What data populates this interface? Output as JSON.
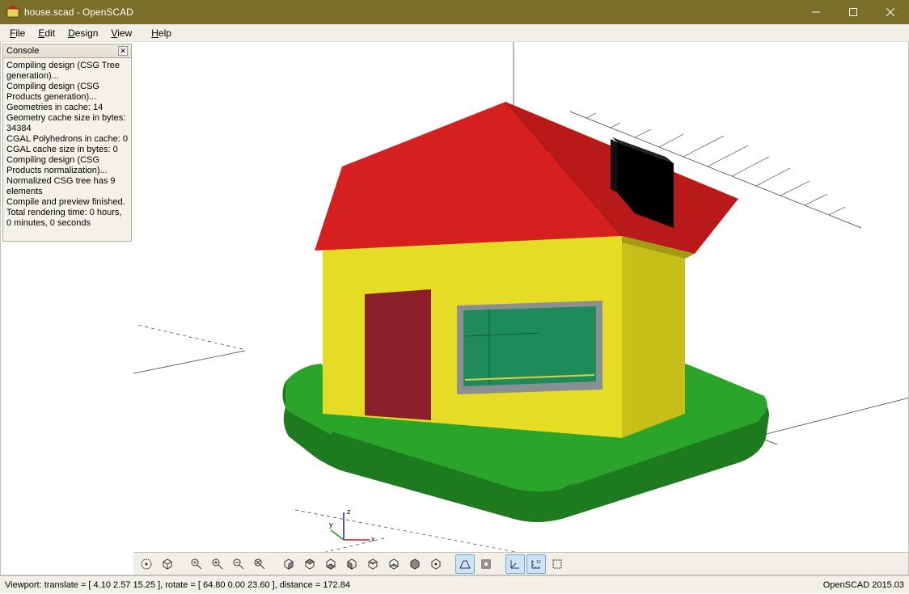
{
  "window": {
    "title": "house.scad - OpenSCAD"
  },
  "menu": {
    "file": "File",
    "edit": "Edit",
    "design": "Design",
    "view": "View",
    "help": "Help"
  },
  "console": {
    "title": "Console",
    "lines": [
      "Compiling design (CSG Tree generation)...",
      "Compiling design (CSG Products generation)...",
      "Geometries in cache: 14",
      "Geometry cache size in bytes: 34384",
      "CGAL Polyhedrons in cache: 0",
      "CGAL cache size in bytes: 0",
      "Compiling design (CSG Products normalization)...",
      "Normalized CSG tree has 9 elements",
      "Compile and preview finished.",
      "Total rendering time: 0 hours, 0 minutes, 0 seconds"
    ]
  },
  "axis": {
    "x": "x",
    "y": "y",
    "z": "z"
  },
  "toolbar": {
    "preview": "preview",
    "render": "render",
    "view_all": "view-all",
    "zoom_in": "zoom-in",
    "zoom_out": "zoom-out",
    "reset_view": "reset-view",
    "right": "right",
    "top": "top",
    "bottom": "bottom",
    "left": "left",
    "front": "front",
    "back": "back",
    "diagonal": "diagonal",
    "center": "center",
    "perspective": "perspective",
    "orthogonal": "orthogonal",
    "show_axes": "show-axes",
    "show_scale": "show-scale",
    "show_crosshairs": "show-crosshairs"
  },
  "status": {
    "left": "Viewport: translate = [ 4.10 2.57 15.25 ], rotate = [ 64.80 0.00 23.60 ], distance = 172.84",
    "right": "OpenSCAD 2015.03"
  },
  "model": {
    "colors": {
      "roof": "#d21f1f",
      "walls": "#dbd21f",
      "door": "#8b1f2a",
      "window_frame": "#8a8f93",
      "window_glass": "#1f8a5a",
      "chimney": "#000000",
      "ground": "#2aa52a",
      "ground_side": "#1e7a1e"
    }
  }
}
